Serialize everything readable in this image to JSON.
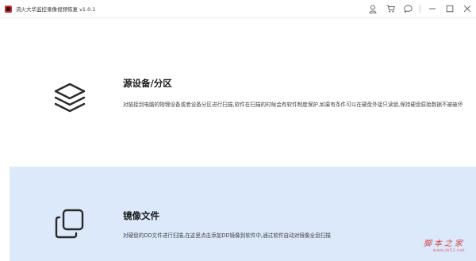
{
  "window": {
    "title": "流火大华监控录像视频恢复 v1.0.1"
  },
  "titlebar": {
    "icons": [
      "user-icon",
      "cart-icon",
      "message-icon",
      "minimize-icon",
      "maximize-icon",
      "close-icon"
    ]
  },
  "options": [
    {
      "id": "device",
      "title": "源设备/分区",
      "description": "对链接到电脑的物理设备或者设备分区进行扫描,软件在扫描的时候会有软件制度保护,如果有条件可以在硬盘外接只读锁,保持硬盘原始数据不被破坏",
      "icon": "layers-icon",
      "selected": false
    },
    {
      "id": "image",
      "title": "镜像文件",
      "description": "对硬盘的DD文件进行扫描,在这里点击添加DD镜像到软件中,通过软件自动对镜像全盘扫描",
      "icon": "copy-icon",
      "selected": true
    }
  ],
  "colors": {
    "selected_bg": "#dbe9fb",
    "brand": "#d12a2a"
  },
  "watermark": {
    "main": "脚本之家",
    "sub": "www.jb51.net"
  }
}
